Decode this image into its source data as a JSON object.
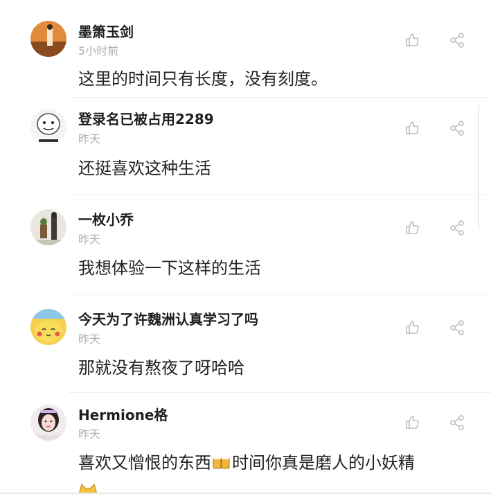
{
  "comments": [
    {
      "username": "墨箫玉剑",
      "time": "5小时前",
      "text": "这里的时间只有长度，没有刻度。",
      "avatar_icon": "orange-scene-avatar"
    },
    {
      "username": "登录名已被占用2289",
      "time": "昨天",
      "text": "还挺喜欢这种生活",
      "avatar_icon": "meme-face-avatar"
    },
    {
      "username": "一枚小乔",
      "time": "昨天",
      "text": "我想体验一下这样的生活",
      "avatar_icon": "photo-couple-avatar"
    },
    {
      "username": "今天为了许魏洲认真学习了吗",
      "time": "昨天",
      "text": "那就没有熬夜了呀哈哈",
      "avatar_icon": "pikachu-avatar"
    },
    {
      "username": "Hermione格",
      "time": "昨天",
      "text_before_emoji": "喜欢又憎恨的东西",
      "text_after_emoji": "时间你真是磨人的小妖精",
      "emoji": "beer-mugs-emoji",
      "avatar_icon": "girl-portrait-avatar"
    }
  ],
  "icons": {
    "like": "thumbs-up-icon",
    "share": "share-icon"
  },
  "colors": {
    "username": "#1f1f1f",
    "timestamp": "#b0b0b0",
    "content": "#222222",
    "icon": "#c4c4c4"
  }
}
